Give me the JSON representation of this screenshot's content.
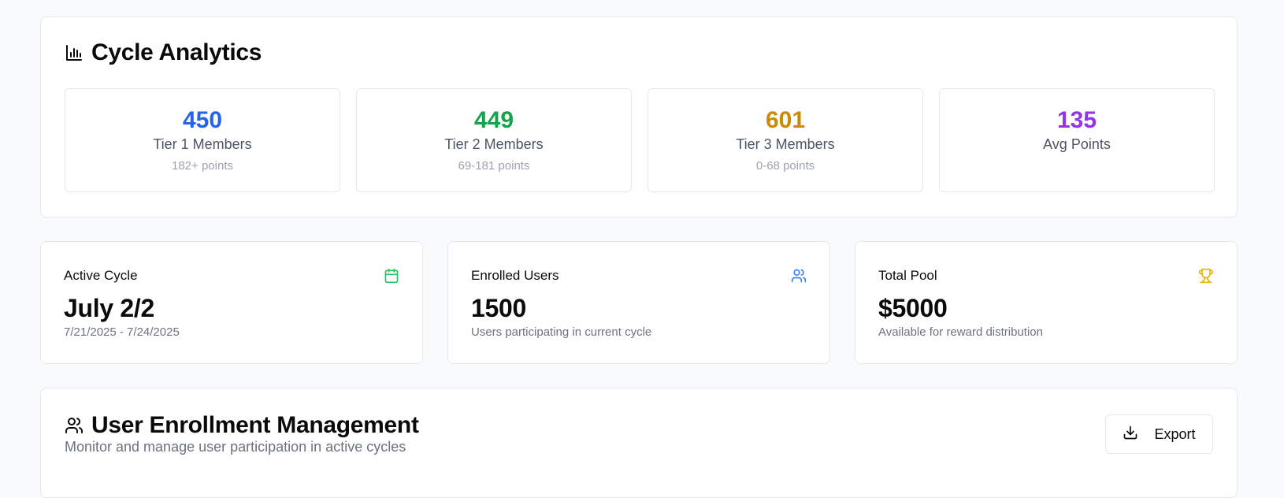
{
  "analytics": {
    "title": "Cycle Analytics",
    "icon": "bar-chart-icon",
    "tiers": [
      {
        "value": "450",
        "label": "Tier 1 Members",
        "sub": "182+ points",
        "color": "#2563eb"
      },
      {
        "value": "449",
        "label": "Tier 2 Members",
        "sub": "69-181 points",
        "color": "#16a34a"
      },
      {
        "value": "601",
        "label": "Tier 3 Members",
        "sub": "0-68 points",
        "color": "#ca8a04"
      },
      {
        "value": "135",
        "label": "Avg Points",
        "sub": "",
        "color": "#9333ea"
      }
    ]
  },
  "stats": [
    {
      "label": "Active Cycle",
      "value": "July 2/2",
      "desc": "7/21/2025 - 7/24/2025",
      "icon": "calendar-icon",
      "color": "#22c55e"
    },
    {
      "label": "Enrolled Users",
      "value": "1500",
      "desc": "Users participating in current cycle",
      "icon": "users-icon",
      "color": "#3b82f6"
    },
    {
      "label": "Total Pool",
      "value": "$5000",
      "desc": "Available for reward distribution",
      "icon": "trophy-icon",
      "color": "#eab308"
    }
  ],
  "enrollment": {
    "title": "User Enrollment Management",
    "description": "Monitor and manage user participation in active cycles",
    "icon": "users-icon",
    "export_label": "Export",
    "export_icon": "download-icon"
  }
}
